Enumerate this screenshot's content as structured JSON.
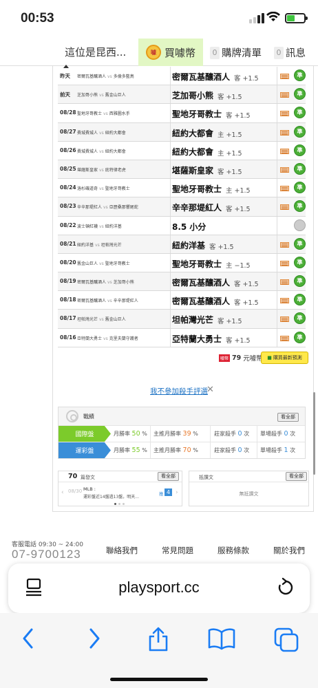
{
  "status_bar": {
    "time": "00:53"
  },
  "header": {
    "site_title": "這位是昆西...",
    "buy_coins": "買噱幣",
    "coin_badge": "噱",
    "cart_count": "0",
    "cart_label": "購牌清單",
    "msg_count": "0",
    "msg_label": "訊息"
  },
  "picks": [
    {
      "date": "昨天",
      "away": "密爾瓦基釀酒人",
      "home": "多倫多藍鳥",
      "pick": "密爾瓦基釀酒人",
      "side": "客 +1.5",
      "result": "win"
    },
    {
      "date": "前天",
      "away": "芝加哥小熊",
      "home": "舊金山巨人",
      "pick": "芝加哥小熊",
      "side": "客 +1.5",
      "result": "win"
    },
    {
      "date": "08/28",
      "away": "聖地牙哥教士",
      "home": "西雅圖水手",
      "pick": "聖地牙哥教士",
      "side": "客 +1.5",
      "result": "win"
    },
    {
      "date": "08/27",
      "away": "費城費城人",
      "home": "紐約大都會",
      "pick": "紐約大都會",
      "side": "主 +1.5",
      "result": "win"
    },
    {
      "date": "08/26",
      "away": "費城費城人",
      "home": "紐約大都會",
      "pick": "紐約大都會",
      "side": "主 +1.5",
      "result": "win"
    },
    {
      "date": "08/25",
      "away": "堪薩斯皇家",
      "home": "底特律老虎",
      "pick": "堪薩斯皇家",
      "side": "客 +1.5",
      "result": "win"
    },
    {
      "date": "08/24",
      "away": "洛杉磯道奇",
      "home": "聖地牙哥教士",
      "pick": "聖地牙哥教士",
      "side": "主 +1.5",
      "result": "win"
    },
    {
      "date": "08/23",
      "away": "辛辛那堤紅人",
      "home": "亞歷桑那響尾蛇",
      "pick": "辛辛那堤紅人",
      "side": "客 +1.5",
      "result": "win"
    },
    {
      "date": "08/22",
      "away": "波士頓紅襪",
      "home": "紐約洋基",
      "pick": "8.5 小分",
      "side": "",
      "result": "none"
    },
    {
      "date": "08/21",
      "away": "紐約洋基",
      "home": "坦帕灣光芒",
      "pick": "紐約洋基",
      "side": "客 +1.5",
      "result": "win"
    },
    {
      "date": "08/20",
      "away": "舊金山巨人",
      "home": "聖地牙哥教士",
      "pick": "聖地牙哥教士",
      "side": "主 −1.5",
      "result": "win"
    },
    {
      "date": "08/19",
      "away": "密爾瓦基釀酒人",
      "home": "芝加哥小熊",
      "pick": "密爾瓦基釀酒人",
      "side": "客 +1.5",
      "result": "win"
    },
    {
      "date": "08/18",
      "away": "密爾瓦基釀酒人",
      "home": "辛辛那堤紅人",
      "pick": "密爾瓦基釀酒人",
      "side": "客 +1.5",
      "result": "win"
    },
    {
      "date": "08/17",
      "away": "坦帕灣光芒",
      "home": "舊金山巨人",
      "pick": "坦帕灣光芒",
      "side": "客 +1.5",
      "result": "win"
    },
    {
      "date": "08/16",
      "away": "亞特蘭大勇士",
      "home": "克里夫蘭守護者",
      "pick": "亞特蘭大勇士",
      "side": "客 +1.5",
      "result": "win"
    }
  ],
  "vs": "vs",
  "win_mark": "準",
  "purchase": {
    "price_tag": "噱幣",
    "price": "79",
    "unit": "元噱幣",
    "button": "購買最新預測"
  },
  "no_join": {
    "text": "我不參加殺手評選",
    "close": "✕"
  },
  "record": {
    "title": "戰績",
    "view_all": "看全部",
    "rows": [
      {
        "label": "國際盤",
        "month_win_label": "月勝率",
        "month_win": "50",
        "home_win_label": "主推月勝率",
        "home_win": "39",
        "banker_label": "莊家殺手",
        "banker": "0",
        "single_label": "單場殺手",
        "single": "0",
        "color": "#7ccb2b"
      },
      {
        "label": "運彩盤",
        "month_win_label": "月勝率",
        "month_win": "55",
        "home_win_label": "主推月勝率",
        "home_win": "70",
        "banker_label": "莊家殺手",
        "banker": "0",
        "single_label": "單場殺手",
        "single": "1",
        "color": "#3a8ed8"
      }
    ],
    "percent": "%",
    "times": "次"
  },
  "posts": {
    "count": "70",
    "label": "篇發文",
    "view_all": "看全部",
    "item_date": "08/30",
    "item_tag": "MLB :",
    "item_text": "運彩盤近14盤過13盤，明天...",
    "item_badge_label": "推",
    "item_badge": "4"
  },
  "replies": {
    "label": "抵讚文",
    "view_all": "看全部",
    "empty": "無抵讚文"
  },
  "footer": {
    "hotline": "客服電話 09:30 ~ 24:00",
    "phone": "07-9700123",
    "links": [
      "聯絡我們",
      "常見問題",
      "服務條款",
      "關於我們"
    ]
  },
  "browser": {
    "url": "playsport.cc"
  }
}
